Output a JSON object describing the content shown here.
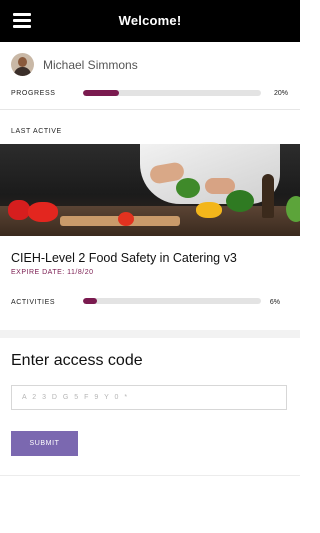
{
  "header": {
    "title": "Welcome!",
    "menu_icon": "hamburger-menu-icon"
  },
  "profile": {
    "name": "Michael Simmons",
    "progress_label": "PROGRESS",
    "progress_value": 0.2,
    "progress_text": "20%"
  },
  "last_active": {
    "label": "LAST ACTIVE",
    "course_title": "CIEH-Level 2 Food Safety in Catering v3",
    "expire_text": "EXPIRE DATE: 11/8/20",
    "activities_label": "ACTIVITIES",
    "activities_value": 0.06,
    "activities_text": "6%"
  },
  "access": {
    "heading": "Enter access code",
    "placeholder": "A 2 3 D G 5 F 9 Y 0 *",
    "value": "",
    "submit_label": "SUBMIT"
  },
  "colors": {
    "header_bg": "#000000",
    "accent": "#7a1a4f",
    "button": "#7b68b0"
  }
}
